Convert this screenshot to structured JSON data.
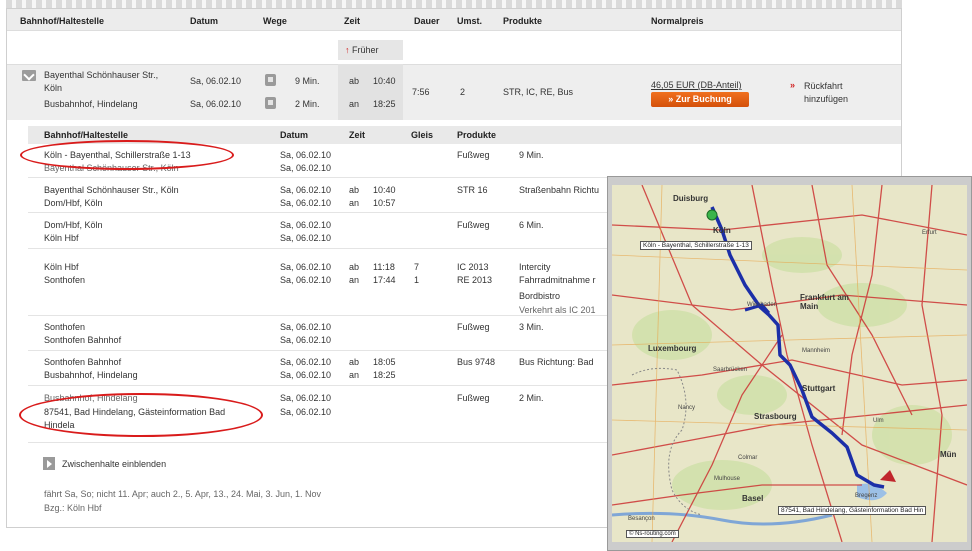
{
  "table": {
    "headers": {
      "station": "Bahnhof/Haltestelle",
      "date": "Datum",
      "route": "Wege",
      "time": "Zeit",
      "duration": "Dauer",
      "changes": "Umst.",
      "products": "Produkte",
      "price": "Normalpreis"
    },
    "earlier": "Früher",
    "connection": {
      "from_station": "Bayenthal Schönhauser Str.,",
      "from_city": "Köln",
      "to_station": "Busbahnhof, Hindelang",
      "from_date": "Sa, 06.02.10",
      "to_date": "Sa, 06.02.10",
      "from_walk": "9 Min.",
      "to_walk": "2 Min.",
      "dep_label": "ab",
      "arr_label": "an",
      "dep_time": "10:40",
      "arr_time": "18:25",
      "duration": "7:56",
      "changes": "2",
      "products": "STR, IC, RE, Bus",
      "price": "46,05 EUR (DB-Anteil)",
      "book_button": "» Zur Buchung",
      "return_link": "Rückfahrt hinzufügen",
      "return_arrow": "»"
    }
  },
  "details": {
    "headers": {
      "station": "Bahnhof/Haltestelle",
      "date": "Datum",
      "time": "Zeit",
      "track": "Gleis",
      "products": "Produkte"
    },
    "legs": [
      {
        "from": "Köln - Bayenthal, Schillerstraße 1-13",
        "to": "Bayenthal Schönhauser Str., Köln",
        "from_date": "Sa, 06.02.10",
        "to_date": "Sa, 06.02.10",
        "dep_lbl": "",
        "arr_lbl": "",
        "dep": "",
        "arr": "",
        "track1": "",
        "track2": "",
        "product": "Fußweg",
        "info": "9 Min."
      },
      {
        "from": "Bayenthal Schönhauser Str., Köln",
        "to": "Dom/Hbf, Köln",
        "from_date": "Sa, 06.02.10",
        "to_date": "Sa, 06.02.10",
        "dep_lbl": "ab",
        "arr_lbl": "an",
        "dep": "10:40",
        "arr": "10:57",
        "track1": "",
        "track2": "",
        "product": "STR 16",
        "info": "Straßenbahn Richtu"
      },
      {
        "from": "Dom/Hbf, Köln",
        "to": "Köln Hbf",
        "from_date": "Sa, 06.02.10",
        "to_date": "Sa, 06.02.10",
        "dep_lbl": "",
        "arr_lbl": "",
        "dep": "",
        "arr": "",
        "track1": "",
        "track2": "",
        "product": "Fußweg",
        "info": "6 Min."
      },
      {
        "from": "Köln Hbf",
        "to": "Sonthofen",
        "from_date": "Sa, 06.02.10",
        "to_date": "Sa, 06.02.10",
        "dep_lbl": "ab",
        "arr_lbl": "an",
        "dep": "11:18",
        "arr": "17:44",
        "track1": "7",
        "track2": "1",
        "product": "IC 2013",
        "product2": "RE 2013",
        "info": "Intercity",
        "info2": "Fahrradmitnahme r",
        "info3": "Bordbistro",
        "info4": "Verkehrt als IC 201"
      },
      {
        "from": "Sonthofen",
        "to": "Sonthofen Bahnhof",
        "from_date": "Sa, 06.02.10",
        "to_date": "Sa, 06.02.10",
        "dep_lbl": "",
        "arr_lbl": "",
        "dep": "",
        "arr": "",
        "track1": "",
        "track2": "",
        "product": "Fußweg",
        "info": "3 Min."
      },
      {
        "from": "Sonthofen Bahnhof",
        "to": "Busbahnhof, Hindelang",
        "from_date": "Sa, 06.02.10",
        "to_date": "Sa, 06.02.10",
        "dep_lbl": "ab",
        "arr_lbl": "an",
        "dep": "18:05",
        "arr": "18:25",
        "track1": "",
        "track2": "",
        "product": "Bus 9748",
        "info": "Bus Richtung: Bad"
      },
      {
        "from": "Busbahnhof, Hindelang",
        "to": "87541, Bad Hindelang, Gästeinformation Bad",
        "to2": "Hindela",
        "from_date": "Sa, 06.02.10",
        "to_date": "Sa, 06.02.10",
        "dep_lbl": "",
        "arr_lbl": "",
        "dep": "",
        "arr": "",
        "track1": "",
        "track2": "",
        "product": "Fußweg",
        "info": "2 Min."
      }
    ],
    "intermediate_stops": "Zwischenhalte einblenden",
    "operating_days": "fährt Sa, So; nicht 11. Apr; auch 2., 5. Apr, 13., 24. Mai, 3. Jun, 1. Nov",
    "train_info": "Bzg.: Köln Hbf"
  },
  "map": {
    "start_label": "Köln - Bayenthal, Schillerstraße 1-13",
    "end_label": "87541, Bad Hindelang, Gästeinformation Bad Hin",
    "copyright": "© Ns-routing.com",
    "cities": [
      {
        "name": "Duisburg"
      },
      {
        "name": "Köln"
      },
      {
        "name": "Erfurt"
      },
      {
        "name": "Frankfurt am Main"
      },
      {
        "name": "Wiesbaden"
      },
      {
        "name": "Luxembourg"
      },
      {
        "name": "Mannheim"
      },
      {
        "name": "Saarbrücken"
      },
      {
        "name": "Stuttgart"
      },
      {
        "name": "Strasbourg"
      },
      {
        "name": "Nancy"
      },
      {
        "name": "Basel"
      },
      {
        "name": "Colmar"
      },
      {
        "name": "Mulhouse"
      },
      {
        "name": "Besançon"
      },
      {
        "name": "Ulm"
      },
      {
        "name": "Mün"
      },
      {
        "name": "Bregenz"
      }
    ],
    "colors": {
      "route": "#1c2fa8",
      "land": "#e8e6c8",
      "road": "#cc3333"
    }
  }
}
